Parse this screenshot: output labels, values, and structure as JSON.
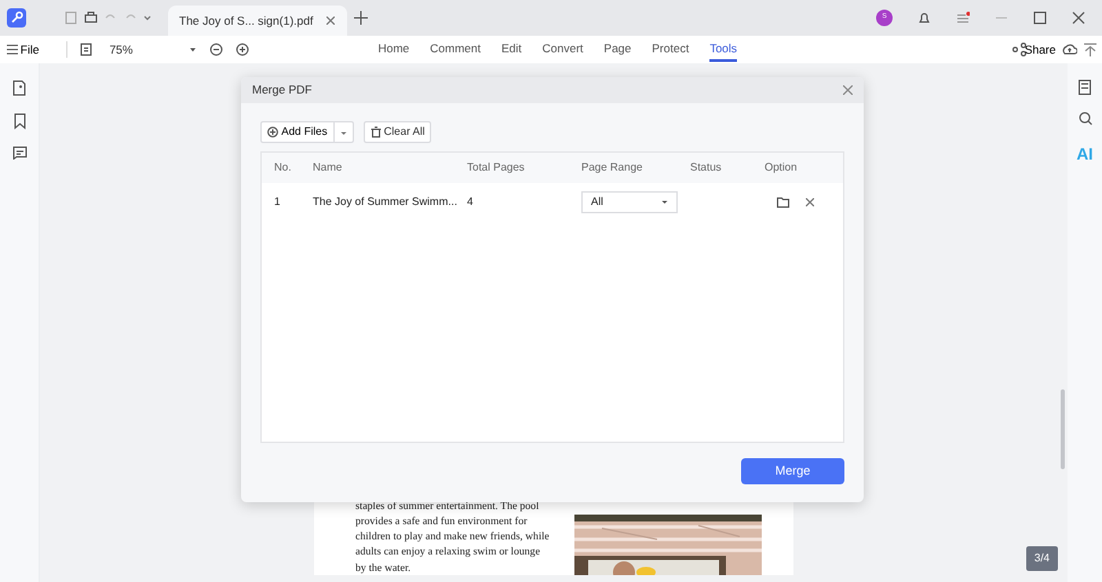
{
  "title_bar": {
    "document_tab": "The Joy of S... sign(1).pdf",
    "avatar": "S"
  },
  "toolbar": {
    "file": "File",
    "zoom": "75%",
    "tabs": [
      {
        "label": "Home",
        "selected": false
      },
      {
        "label": "Comment",
        "selected": false
      },
      {
        "label": "Edit",
        "selected": false
      },
      {
        "label": "Convert",
        "selected": false
      },
      {
        "label": "Page",
        "selected": false
      },
      {
        "label": "Protect",
        "selected": false
      },
      {
        "label": "Tools",
        "selected": true
      }
    ],
    "share": "Share"
  },
  "right_panel": {
    "ai": "AI"
  },
  "dialog": {
    "title": "Merge PDF",
    "add_files": "Add Files",
    "clear_all": "Clear All",
    "columns": [
      "No.",
      "Name",
      "Total Pages",
      "Page Range",
      "Status",
      "Option"
    ],
    "rows": [
      {
        "no": "1",
        "name": "The Joy of Summer Swimm...",
        "total_pages": "4",
        "page_range": "All"
      }
    ],
    "merge": "Merge"
  },
  "page": {
    "paragraph": "staples of summer entertainment. The pool provides a safe and fun environment for children to play and make new friends, while adults can enjoy a relaxing swim or lounge by the water."
  },
  "page_counter": "3/4"
}
